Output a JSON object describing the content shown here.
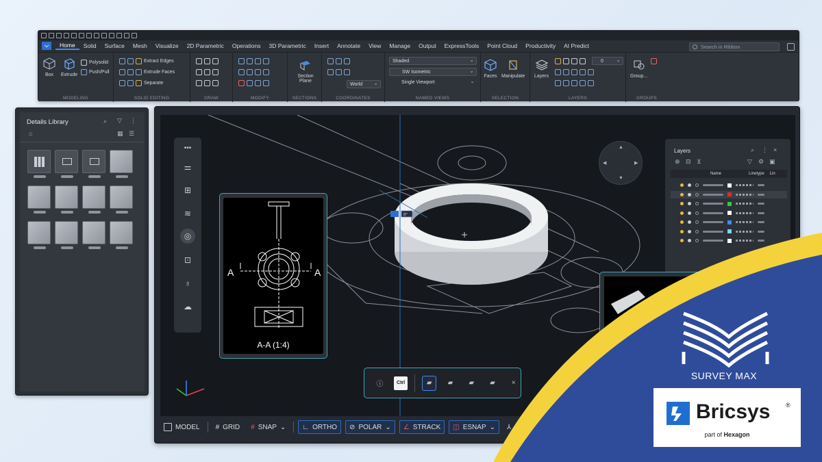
{
  "ribbon": {
    "tabs": [
      "Home",
      "Solid",
      "Surface",
      "Mesh",
      "Visualize",
      "2D Parametric",
      "Operations",
      "3D Parametric",
      "Insert",
      "Annotate",
      "View",
      "Manage",
      "Output",
      "ExpressTools",
      "Point Cloud",
      "Productivity",
      "AI Predict"
    ],
    "active_tab": "Home",
    "search_placeholder": "Search in Ribbon",
    "panels": {
      "modeling": {
        "title": "MODELING",
        "box": "Box",
        "extrude": "Extrude",
        "polysolid": "Polysolid",
        "pushpull": "Push/Pull"
      },
      "solid_editing": {
        "title": "SOLID EDITING",
        "extract_edges": "Extract Edges",
        "extrude_faces": "Extrude Faces",
        "separate": "Separate"
      },
      "draw": {
        "title": "DRAW"
      },
      "modify": {
        "title": "MODIFY"
      },
      "sections": {
        "title": "SECTIONS",
        "section_plane": "Section Plane"
      },
      "coordinates": {
        "title": "COORDINATES",
        "world": "World"
      },
      "named_views": {
        "title": "NAMED VIEWS",
        "visual_style": "Shaded",
        "view": "SW Isometric",
        "viewport": "Single Viewport"
      },
      "selection": {
        "title": "SELECTION",
        "faces": "Faces",
        "manipulate": "Manipulate"
      },
      "layers": {
        "title": "LAYERS",
        "layers_btn": "Layers",
        "current_layer": "0"
      },
      "groups": {
        "title": "GROUPS",
        "group_btn": "Group..."
      }
    }
  },
  "library": {
    "title": "Details Library"
  },
  "detail_view": {
    "label_left": "A",
    "label_right": "A",
    "caption": "A-A (1:4)"
  },
  "layers_panel": {
    "title": "Layers",
    "col_name": "Name",
    "col_linetype": "Linetype",
    "col_lineweight": "Lin",
    "row_colors": [
      "#ffffff",
      "#e02a2a",
      "#2ecc40",
      "#ffffff",
      "#3d8bfd",
      "#7fd3ff",
      "#ffffff"
    ]
  },
  "quickbar": {
    "ctrl_label": "Ctrl"
  },
  "statusbar": {
    "model": "MODEL",
    "grid": "GRID",
    "snap": "SNAP",
    "ortho": "ORTHO",
    "polar": "POLAR",
    "strack": "STRACK",
    "esnap": "ESNAP"
  },
  "branding": {
    "surveymax": "SURVEY MAX",
    "bricsys": "Bricsys",
    "registered": "®",
    "part_of": "part of",
    "hexagon": "Hexagon",
    "colors": {
      "navy": "#2f4c9b",
      "yellow": "#f4d23c",
      "bricsys_blue": "#1f6fd1"
    }
  },
  "canvas": {
    "dim_value": "0°"
  }
}
